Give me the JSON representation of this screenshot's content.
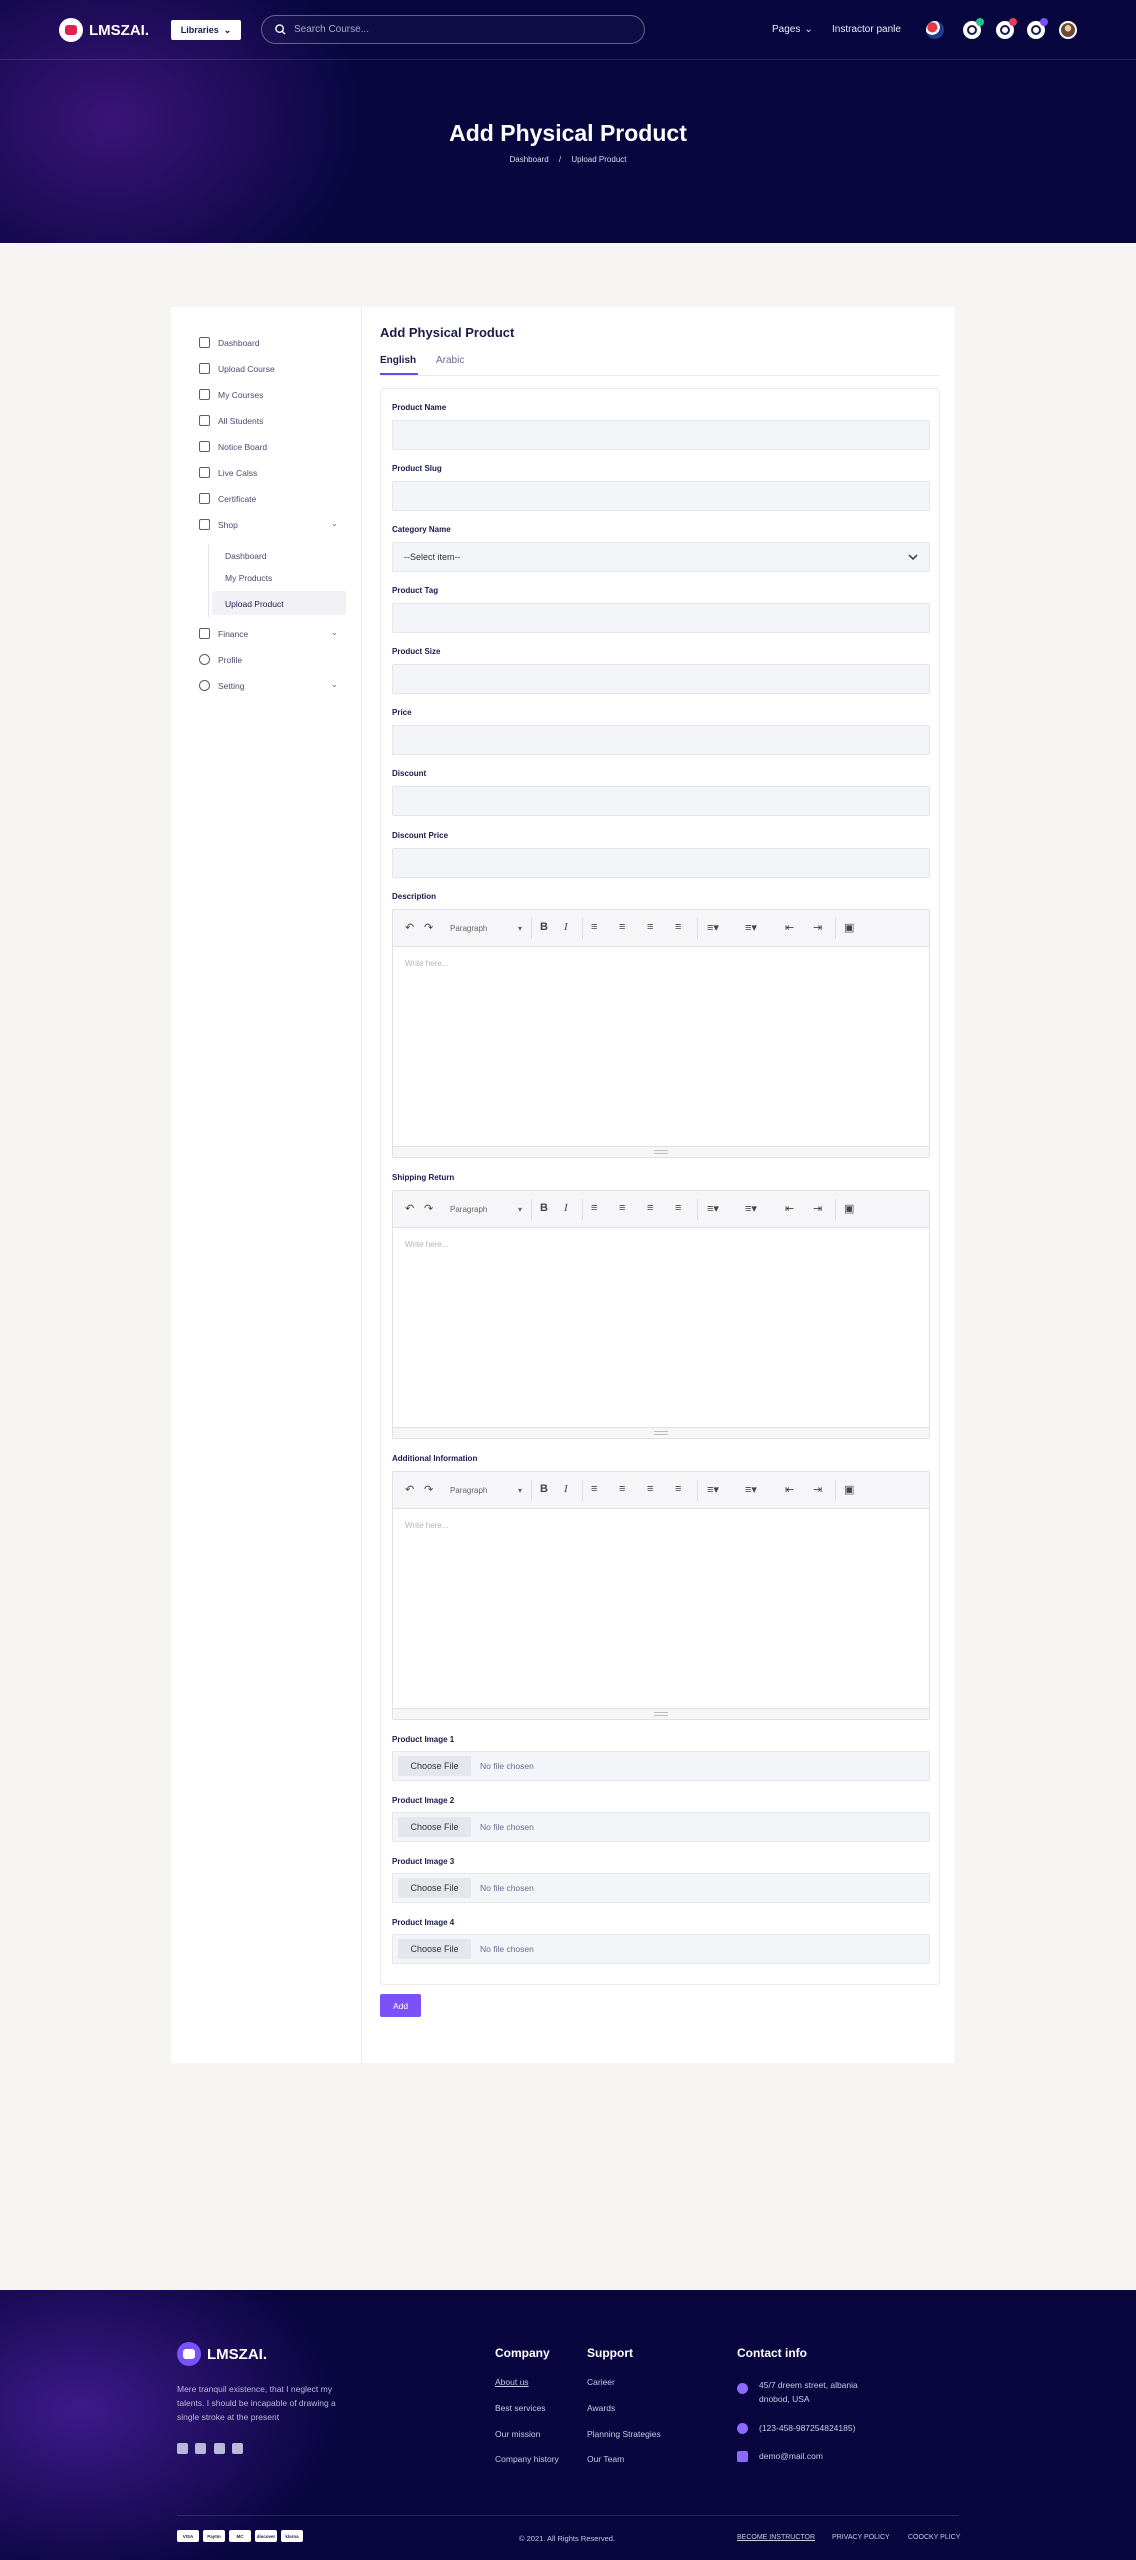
{
  "header": {
    "brand": "LMSZAI.",
    "libraries_label": "Libraries",
    "search_placeholder": "Search Course...",
    "pages_label": "Pages",
    "instructor_label": "Instractor panle"
  },
  "hero": {
    "title": "Add Physical Product",
    "breadcrumb": [
      "Dashboard",
      "/",
      "Upload Product"
    ]
  },
  "sidebar": {
    "items": [
      {
        "label": "Dashboard",
        "icon": "home-icon"
      },
      {
        "label": "Upload Course",
        "icon": "upload-icon"
      },
      {
        "label": "My Courses",
        "icon": "book-icon"
      },
      {
        "label": "All Students",
        "icon": "students-icon"
      },
      {
        "label": "Notice Board",
        "icon": "notice-icon"
      },
      {
        "label": "Live Calss",
        "icon": "broadcast-icon"
      },
      {
        "label": "Certificate",
        "icon": "certificate-icon"
      },
      {
        "label": "Shop",
        "icon": "shop-icon"
      }
    ],
    "shop_sub": [
      "Dashboard",
      "My Products",
      "Upload Product"
    ],
    "items_after": [
      {
        "label": "Finance",
        "icon": "finance-icon"
      },
      {
        "label": "Profile",
        "icon": "user-icon"
      },
      {
        "label": "Setting",
        "icon": "gear-icon"
      }
    ]
  },
  "form": {
    "title": "Add Physical Product",
    "tabs": [
      "English",
      "Arabic"
    ],
    "labels": {
      "product_name": "Product Name",
      "product_slug": "Product Slug",
      "category_name": "Category Name",
      "product_tag": "Product Tag",
      "product_size": "Product Size",
      "price": "Price",
      "discount": "Discount",
      "discount_price": "Discount Price",
      "description": "Description",
      "shipping_return": "Shipping Return",
      "additional_information": "Additional Information",
      "image1": "Product Image 1",
      "image2": "Product Image 2",
      "image3": "Product Image 3",
      "image4": "Product Image 4"
    },
    "category_value": "--Select item--",
    "editor_placeholder": "Write here...",
    "paragraph_label": "Paragraph",
    "choose_file": "Choose File",
    "no_file": "No file chosen",
    "submit": "Add"
  },
  "footer": {
    "brand": "LMSZAI.",
    "description": "Mere tranquil existence, that I neglect my talents. I should be incapable of drawing a single stroke at the present",
    "company_heading": "Company",
    "company_links": [
      "About us",
      "Best services",
      "Our mission",
      "Company history"
    ],
    "support_heading": "Support",
    "support_links": [
      "Carieer",
      "Awards",
      "Planning Strategies",
      "Our Team"
    ],
    "contact_heading": "Contact info",
    "address": "45/7 dreem street, albania dnobod, USA",
    "phone": "(123-458-987254824185)",
    "email": "demo@mail.com",
    "copyright": "© 2021. All Rights Reserved.",
    "bottom_links": [
      "BECOME INSTRUCTOR",
      "PRIVACY POLICY",
      "COOCKY PLICY"
    ],
    "payments": [
      "VISA",
      "Paytm",
      "MC",
      "discover",
      "klarna"
    ]
  },
  "colors": {
    "accent": "#7b52f8",
    "hero_bg": "#07063f",
    "footer_bg": "#09053f"
  }
}
